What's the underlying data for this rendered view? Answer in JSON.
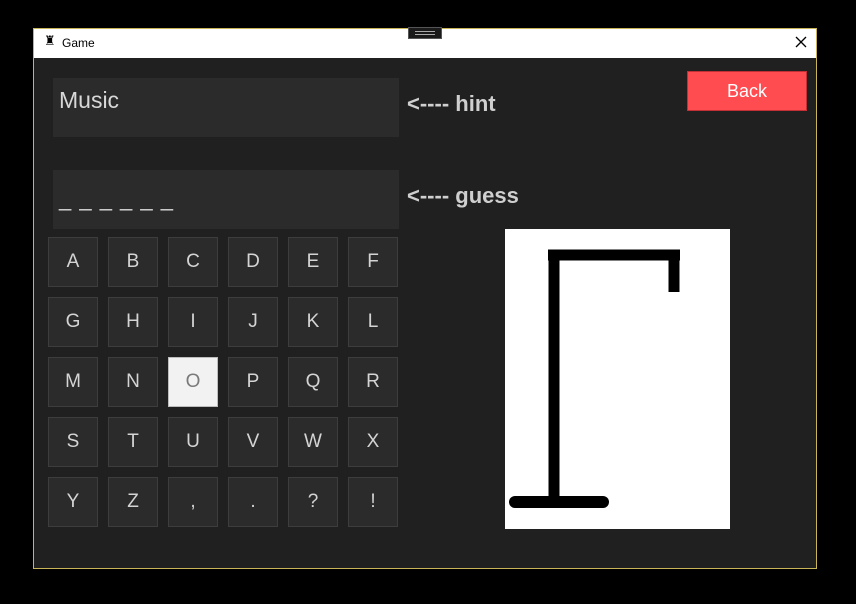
{
  "window": {
    "title": "Game"
  },
  "hint": {
    "value": "Music",
    "label": "<---- hint"
  },
  "guess": {
    "value": "_ _ _ _ _ _",
    "label": "<---- guess"
  },
  "back_button": {
    "label": "Back",
    "color": "#ff4c51"
  },
  "keyboard": {
    "keys": [
      "A",
      "B",
      "C",
      "D",
      "E",
      "F",
      "G",
      "H",
      "I",
      "J",
      "K",
      "L",
      "M",
      "N",
      "O",
      "P",
      "Q",
      "R",
      "S",
      "T",
      "U",
      "V",
      "W",
      "X",
      "Y",
      "Z",
      ",",
      ".",
      "?",
      "!"
    ],
    "pressed": [
      "O"
    ]
  },
  "gallows": {
    "stage": 1,
    "parts_drawn": [
      "base",
      "pole",
      "beam",
      "rope"
    ]
  },
  "colors": {
    "background": "#202020",
    "border": "#c9b458",
    "key": "#2b2b2b"
  }
}
